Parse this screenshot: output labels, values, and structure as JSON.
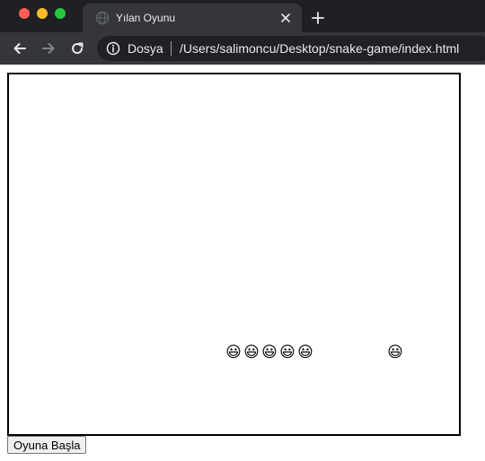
{
  "browser": {
    "tab_title": "Yılan Oyunu",
    "site_label": "Dosya",
    "url": "/Users/salimoncu/Desktop/snake-game/index.html",
    "icons": {
      "tab": "globe-icon",
      "close": "close-icon",
      "new_tab": "plus-icon",
      "back": "back-arrow-icon",
      "forward": "forward-arrow-icon",
      "reload": "reload-icon",
      "info": "info-icon"
    }
  },
  "game": {
    "snake_glyph": "😃",
    "food_glyph": "😃",
    "grid_columns": 25,
    "grid_rows": 20,
    "snake_cells": [
      [
        12,
        15
      ],
      [
        13,
        15
      ],
      [
        14,
        15
      ],
      [
        15,
        15
      ],
      [
        16,
        15
      ]
    ],
    "food_cell": [
      21,
      15
    ],
    "start_button_label": "Oyuna Başla"
  },
  "colors": {
    "chrome_dark": "#1f2023",
    "chrome_tab": "#35363a",
    "omnibox": "#202124",
    "board_border": "#000000"
  }
}
